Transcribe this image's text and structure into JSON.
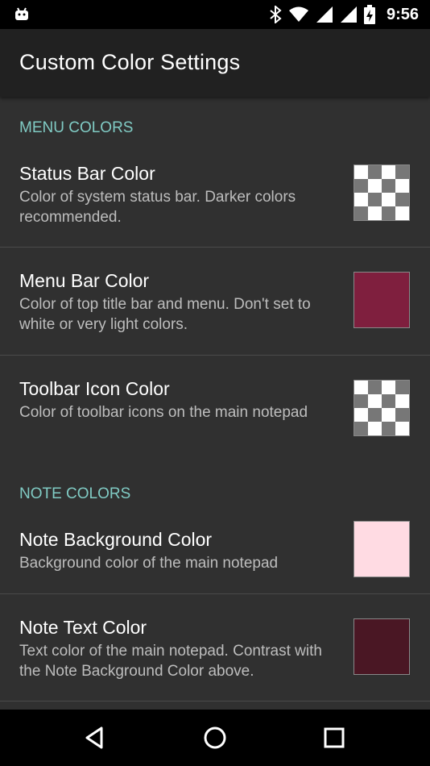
{
  "status_bar": {
    "time": "9:56",
    "icons": [
      "android-icon",
      "bluetooth-icon",
      "wifi-icon",
      "signal-icon",
      "signal-icon",
      "battery-charging-icon"
    ]
  },
  "app_bar": {
    "title": "Custom Color Settings"
  },
  "sections": [
    {
      "header": "MENU COLORS",
      "items": [
        {
          "title": "Status Bar Color",
          "summary": "Color of system status bar. Darker colors recommended.",
          "swatch": "transparent-checker"
        },
        {
          "title": "Menu Bar Color",
          "summary": "Color of top title bar and menu. Don't set to white or very light colors.",
          "swatch": "#7f1f3e"
        },
        {
          "title": "Toolbar Icon Color",
          "summary": "Color of toolbar icons on the main notepad",
          "swatch": "transparent-checker"
        }
      ]
    },
    {
      "header": "NOTE COLORS",
      "items": [
        {
          "title": "Note Background Color",
          "summary": "Background color of the main notepad",
          "swatch": "#ffdbe3"
        },
        {
          "title": "Note Text Color",
          "summary": "Text color of the main notepad. Contrast with the Note Background Color above.",
          "swatch": "#4a1724"
        }
      ]
    }
  ],
  "colors": {
    "accent": "#80cbc4",
    "app_bar": "#212121",
    "background": "#303030"
  },
  "nav_bar": {
    "icons": [
      "back-icon",
      "home-icon",
      "recents-icon"
    ]
  }
}
